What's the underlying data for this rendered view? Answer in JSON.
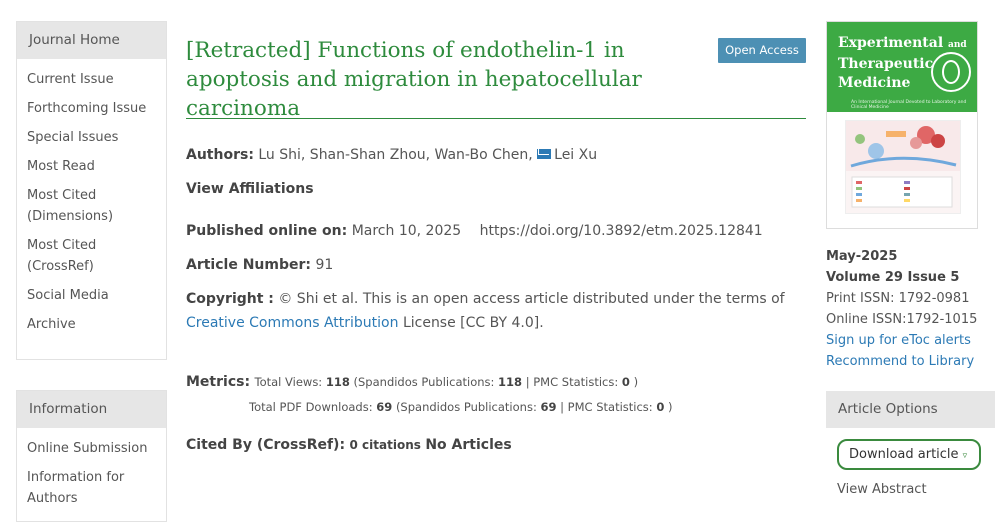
{
  "journal_nav": {
    "title": "Journal Home",
    "items": [
      "Current Issue",
      "Forthcoming Issue",
      "Special Issues",
      "Most Read",
      "Most Cited (Dimensions)",
      "Most Cited (CrossRef)",
      "Social Media",
      "Archive"
    ]
  },
  "info_nav": {
    "title": "Information",
    "items": [
      "Online Submission",
      "Information for Authors"
    ]
  },
  "article": {
    "title": "[Retracted] Functions of endothelin-1 in apoptosis and migration in hepatocellular carcinoma",
    "open_access": "Open Access",
    "authors_label": "Authors:",
    "authors": "Lu Shi, Shan-Shan Zhou, Wan-Bo Chen,",
    "corresponding_author": "Lei Xu",
    "view_affiliations": "View Affiliations",
    "published_label": "Published online on:",
    "published_date": "March 10, 2025",
    "doi": "https://doi.org/10.3892/etm.2025.12841",
    "article_number_label": "Article Number:",
    "article_number": "91",
    "copyright_label": "Copyright :",
    "copyright_text": "© Shi et al. This is an open access article distributed under the terms of",
    "license_link": "Creative Commons Attribution",
    "license_suffix": "License [CC BY 4.0].",
    "metrics_label": "Metrics:",
    "views_label": "Total Views:",
    "views": "118",
    "spandidos_label": "(Spandidos Publications:",
    "views_spandidos": "118",
    "pmc_label": "| PMC Statistics:",
    "views_pmc": "0",
    "close_paren": ")",
    "pdf_label": "Total PDF Downloads:",
    "pdf": "69",
    "pdf_spandidos": "69",
    "pdf_pmc": "0",
    "cited_label": "Cited By (CrossRef):",
    "cited_count": "0 citations",
    "cited_articles": "No Articles"
  },
  "cover": {
    "title_line1": "Experimental",
    "title_and": "and",
    "title_line2": "Therapeutic",
    "title_line3": "Medicine",
    "subtitle": "An International Journal Devoted to Laboratory and Clinical Medicine"
  },
  "issue": {
    "month": "May-2025",
    "volume": "Volume 29 Issue 5",
    "print_issn": "Print ISSN: 1792-0981",
    "online_issn": "Online ISSN:1792-1015",
    "etoc": "Sign up for eToc alerts",
    "recommend": "Recommend to Library"
  },
  "options": {
    "title": "Article Options",
    "download": "Download article",
    "view_abstract": "View Abstract"
  },
  "colors": {
    "title_green": "#2e8b3d",
    "link_blue": "#2c7ab5",
    "badge_blue": "#4d90b4",
    "cover_green": "#3daa44"
  }
}
